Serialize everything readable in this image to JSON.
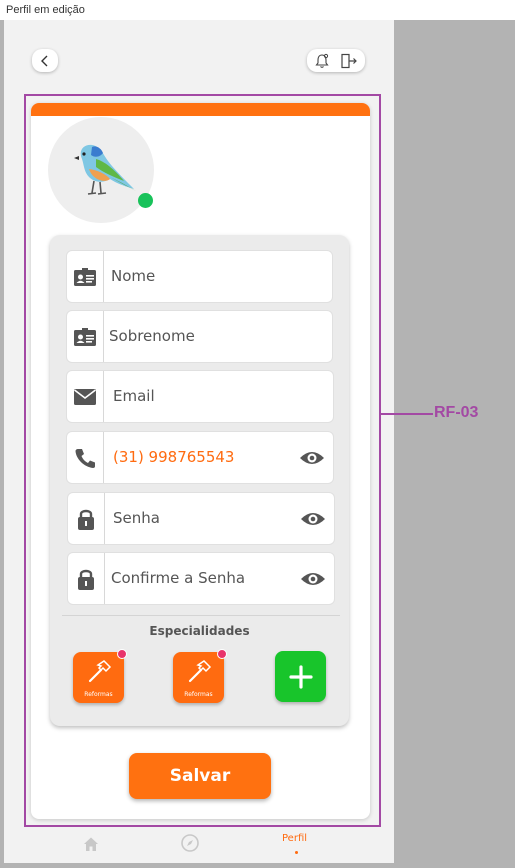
{
  "frame": {
    "title": "Perfil em edição"
  },
  "annotation": {
    "label": "RF-03"
  },
  "header": {
    "back_icon": "chevron-left-icon",
    "notification_icon": "bell-icon",
    "logout_icon": "exit-door-icon"
  },
  "profile": {
    "avatar_icon": "bird-avatar",
    "status": "online"
  },
  "form": {
    "fields": [
      {
        "name": "first-name",
        "icon": "id-card-icon",
        "placeholder": "Nome"
      },
      {
        "name": "last-name",
        "icon": "id-card-icon",
        "placeholder": "Sobrenome"
      },
      {
        "name": "email",
        "icon": "envelope-icon",
        "placeholder": "Email"
      },
      {
        "name": "phone",
        "icon": "phone-icon",
        "value": "(31) 998765543"
      },
      {
        "name": "password",
        "icon": "lock-icon",
        "placeholder": "Senha"
      },
      {
        "name": "confirm-password",
        "icon": "lock-icon",
        "placeholder": "Confirme a Senha"
      }
    ]
  },
  "specialties": {
    "title": "Especialidades",
    "items": [
      {
        "label": "Reformas",
        "icon": "hammer-icon"
      },
      {
        "label": "Reformas",
        "icon": "hammer-icon"
      }
    ],
    "add_icon": "plus-icon"
  },
  "actions": {
    "save_label": "Salvar"
  },
  "nav": {
    "items": [
      {
        "icon": "home-icon"
      },
      {
        "icon": "compass-icon"
      },
      {
        "label": "Perfil"
      }
    ]
  },
  "colors": {
    "accent": "#ff7110",
    "online": "#18c25a",
    "add": "#18c52b",
    "annotation": "#a349a4"
  }
}
